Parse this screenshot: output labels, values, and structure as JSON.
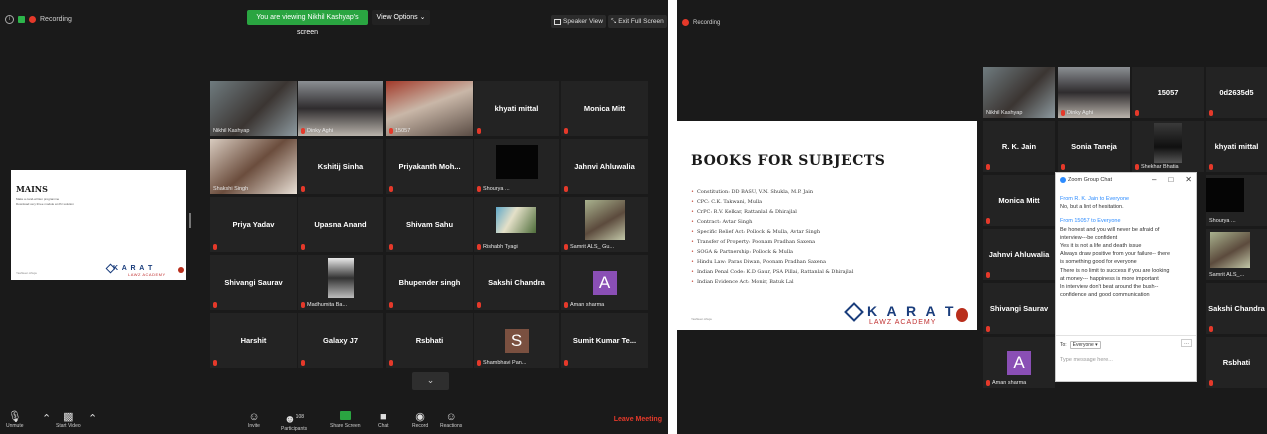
{
  "left": {
    "recording_label": "Recording",
    "banner": "You are viewing Nikhil Kashyap's screen",
    "view_options": "View Options ⌄",
    "speaker_view": "Speaker View",
    "exit_full_screen": "Exit Full Screen",
    "slide": {
      "title": "MAINS",
      "bullets": [
        "Make a cand-written programme",
        "Download very three module at 2hr solution"
      ],
      "brand": "K A R A T",
      "brand_sub": "LAWZ ACADEMY",
      "footer": "Yashleen Ahuja"
    },
    "tiles": [
      {
        "name": "",
        "label": "Nikhil Kashyap"
      },
      {
        "name": "",
        "label": "Dinky Aghi"
      },
      {
        "name": "",
        "label": "15057"
      },
      {
        "name": "khyati mittal",
        "label": ""
      },
      {
        "name": "Monica Mitt",
        "label": ""
      },
      {
        "name": "",
        "label": "Shakshi Singh"
      },
      {
        "name": "Kshitij Sinha",
        "label": ""
      },
      {
        "name": "Priyakanth  Moh...",
        "label": ""
      },
      {
        "name": "",
        "label": "Shourya ..."
      },
      {
        "name": "Jahnvi Ahluwalia",
        "label": ""
      },
      {
        "name": "Priya Yadav",
        "label": ""
      },
      {
        "name": "Upasna Anand",
        "label": ""
      },
      {
        "name": "Shivam Sahu",
        "label": ""
      },
      {
        "name": "",
        "label": "Rishabh Tyagi"
      },
      {
        "name": "",
        "label": "Samrit ALS_ Gu..."
      },
      {
        "name": "Shivangi Saurav",
        "label": ""
      },
      {
        "name": "",
        "label": "Madhumita Ba..."
      },
      {
        "name": "Bhupender singh",
        "label": ""
      },
      {
        "name": "Sakshi Chandra",
        "label": ""
      },
      {
        "name": "A",
        "label": "Aman sharma"
      },
      {
        "name": "Harshit",
        "label": ""
      },
      {
        "name": "Galaxy J7",
        "label": ""
      },
      {
        "name": "Rsbhati",
        "label": ""
      },
      {
        "name": "S",
        "label": "Shambhavi Pan..."
      },
      {
        "name": "Sumit Kumar Te...",
        "label": ""
      }
    ],
    "toolbar": {
      "unmute": "Unmute",
      "start_video": "Start Video",
      "invite": "Invite",
      "participants": "Participants",
      "participants_count": "108",
      "share_screen": "Share Screen",
      "chat": "Chat",
      "record": "Record",
      "reactions": "Reactions",
      "leave": "Leave Meeting"
    }
  },
  "right": {
    "recording_label": "Recording",
    "slide": {
      "title": "BOOKS FOR SUBJECTS",
      "bullets": [
        "Constitution: DD BASU, V.N. Shukla, M.P. Jain",
        "CPC: C.K. Takwani, Mulla",
        "CrPC: R.V. Kelkar, Rattanlal & Dhirajlal",
        "Contract: Avtar Singh",
        "Specific Relief Act: Pollock & Mulla, Avtar Singh",
        "Transfer of Property: Poonam Pradhan Saxena",
        "SOGA & Partnership: Pollock & Mulla",
        "Hindu Law: Paras Diwan, Poonam Pradhan Saxena",
        "Indian Penal Code: K.D Gaur, PSA Pillai, Rattanlal & Dhirajlal",
        "Indian Evidence Act: Monir, Batuk Lal"
      ],
      "brand": "K A R A T",
      "brand_sub": "LAWZ ACADEMY",
      "footer": "Yashleen Ahuja"
    },
    "tiles": [
      {
        "name": "",
        "label": "Nikhil Kashyap"
      },
      {
        "name": "",
        "label": "Dinky Aghi"
      },
      {
        "name": "15057",
        "label": ""
      },
      {
        "name": "0d2635d5",
        "label": ""
      },
      {
        "name": "R. K. Jain",
        "label": ""
      },
      {
        "name": "Sonia Taneja",
        "label": ""
      },
      {
        "name": "",
        "label": "Shekhar Bhatia"
      },
      {
        "name": "khyati mittal",
        "label": ""
      },
      {
        "name": "Monica Mitt",
        "label": ""
      },
      {
        "name": "",
        "label": "Shourya ..."
      },
      {
        "name": "Jahnvi Ahluwalia",
        "label": ""
      },
      {
        "name": "",
        "label": "Samrit ALS_..."
      },
      {
        "name": "Shivangi Saurav",
        "label": ""
      },
      {
        "name": "Sakshi Chandra",
        "label": ""
      },
      {
        "name": "A",
        "label": "Aman sharma"
      },
      {
        "name": "Rsbhati",
        "label": ""
      }
    ],
    "chat": {
      "title": "Zoom Group Chat",
      "from1": "From R. K. Jain to Everyone",
      "msg1": "No, but a lint of hesitation.",
      "from2": "From 15057 to Everyone",
      "msgs": [
        "Be honest and you will never be afraid of",
        "interview---be confident",
        "Yes it is not a life and death issue",
        "Always draw positive from your failure-- there",
        "is something good for everyone",
        "There is no limit to success if you are looking",
        "at money--- happiness is more important",
        "In interview don't beat around the bush--",
        "confidence and good communication"
      ],
      "to_label": "To:",
      "to_value": "Everyone ▾",
      "more": "...",
      "placeholder": "Type message here..."
    }
  }
}
